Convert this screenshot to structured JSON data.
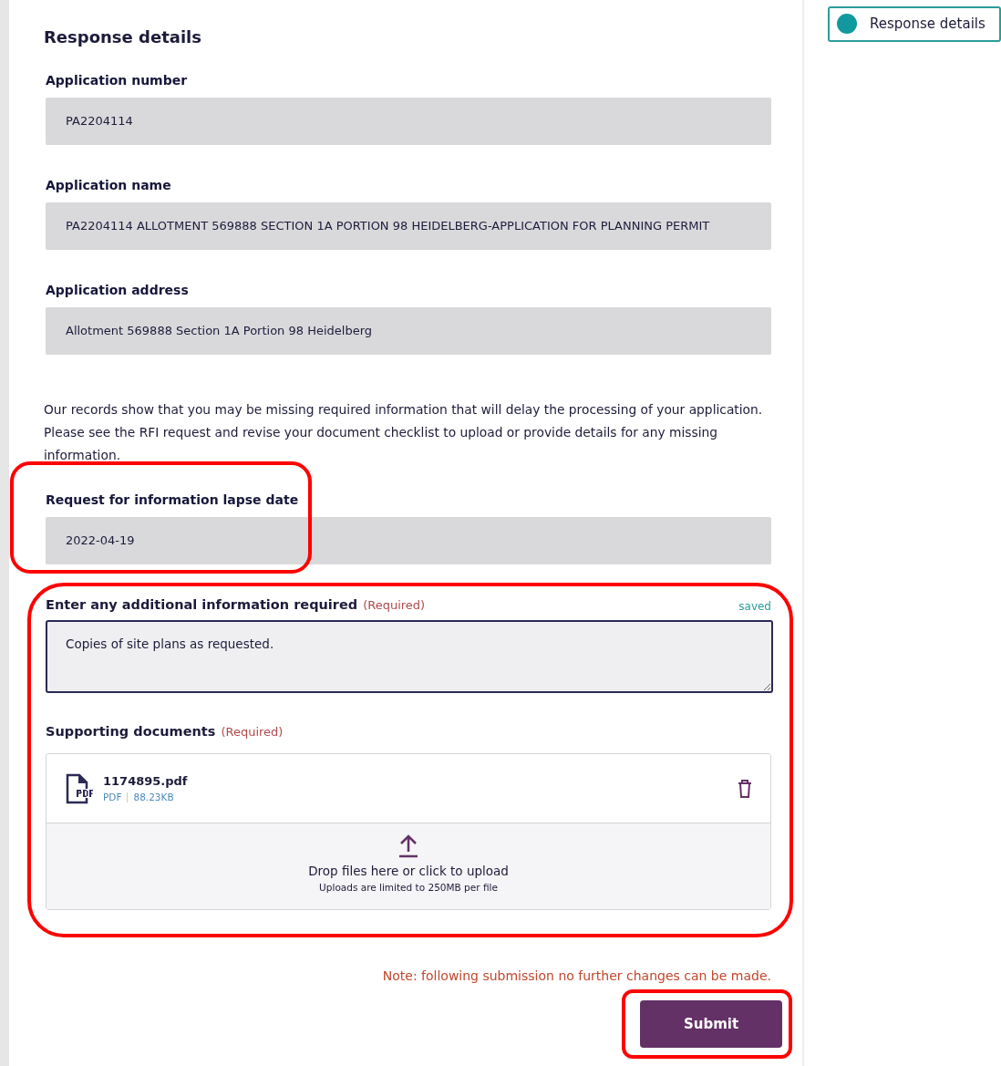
{
  "section_title": "Response details",
  "fields": [
    {
      "label": "Application number",
      "value": "PA2204114"
    },
    {
      "label": "Application name",
      "value": "PA2204114 ALLOTMENT 569888 SECTION 1A PORTION 98 HEIDELBERG-APPLICATION FOR PLANNING PERMIT"
    },
    {
      "label": "Application address",
      "value": "Allotment 569888 Section 1A Portion 98 Heidelberg"
    }
  ],
  "notice": "Our records show that you may be missing required information that will delay the processing of your application. Please see the RFI request and revise your document checklist to upload or provide details for any missing information.",
  "lapse_date": {
    "label": "Request for information lapse date",
    "value": "2022-04-19",
    "highlighted": true
  },
  "additional_info": {
    "label": "Enter any additional information required",
    "required_text": "(Required)",
    "status": "saved",
    "value": "Copies of site plans as requested.",
    "highlighted": true
  },
  "supporting_documents": {
    "label": "Supporting documents",
    "required_text": "(Required)",
    "files": [
      {
        "name": "1174895.pdf",
        "type": "PDF",
        "size": "88.23KB"
      }
    ],
    "dropzone": {
      "title": "Drop files here or click to upload",
      "hint": "Uploads are limited to 250MB per file"
    }
  },
  "note": "Note: following submission no further changes can be made.",
  "submit_button": {
    "label": "Submit",
    "highlighted": true
  },
  "side_nav": [
    {
      "label": "Response details",
      "selected": true
    }
  ]
}
